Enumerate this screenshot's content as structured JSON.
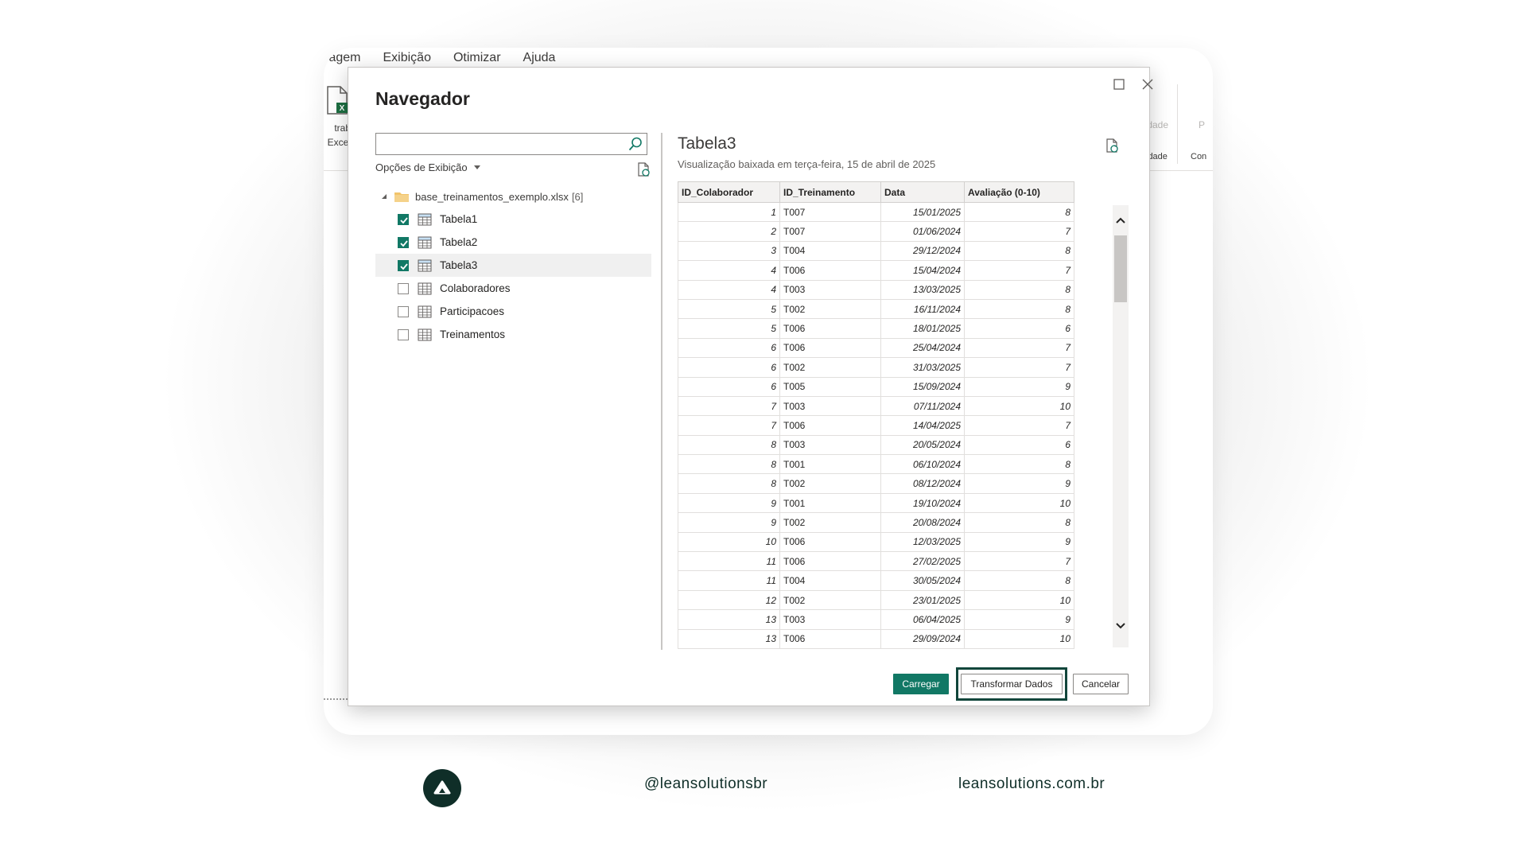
{
  "background_app": {
    "menu": [
      "elagem",
      "Exibição",
      "Otimizar",
      "Ajuda"
    ],
    "excel_label_line1": "trab",
    "excel_label_line2": "Excel",
    "ribbon_right_grey_1": "lidade",
    "ribbon_right_grey_2": "P",
    "ribbon_right_dark_1": "idade",
    "ribbon_right_dark_2": "Con"
  },
  "dialog": {
    "title": "Navegador",
    "search": {
      "value": "",
      "placeholder": ""
    },
    "display_options_label": "Opções de Exibição",
    "tree": {
      "root_label": "base_treinamentos_exemplo.xlsx",
      "root_count": "[6]",
      "items": [
        {
          "label": "Tabela1",
          "checked": true,
          "kind": "table"
        },
        {
          "label": "Tabela2",
          "checked": true,
          "kind": "table"
        },
        {
          "label": "Tabela3",
          "checked": true,
          "kind": "table",
          "selected": true
        },
        {
          "label": "Colaboradores",
          "checked": false,
          "kind": "sheet"
        },
        {
          "label": "Participacoes",
          "checked": false,
          "kind": "sheet"
        },
        {
          "label": "Treinamentos",
          "checked": false,
          "kind": "sheet"
        }
      ]
    },
    "preview": {
      "title": "Tabela3",
      "subtitle": "Visualização baixada em terça-feira, 15 de abril de 2025",
      "columns": [
        "ID_Colaborador",
        "ID_Treinamento",
        "Data",
        "Avaliação (0-10)"
      ],
      "rows": [
        [
          "1",
          "T007",
          "15/01/2025",
          "8"
        ],
        [
          "2",
          "T007",
          "01/06/2024",
          "7"
        ],
        [
          "3",
          "T004",
          "29/12/2024",
          "8"
        ],
        [
          "4",
          "T006",
          "15/04/2024",
          "7"
        ],
        [
          "4",
          "T003",
          "13/03/2025",
          "8"
        ],
        [
          "5",
          "T002",
          "16/11/2024",
          "8"
        ],
        [
          "5",
          "T006",
          "18/01/2025",
          "6"
        ],
        [
          "6",
          "T006",
          "25/04/2024",
          "7"
        ],
        [
          "6",
          "T002",
          "31/03/2025",
          "7"
        ],
        [
          "6",
          "T005",
          "15/09/2024",
          "9"
        ],
        [
          "7",
          "T003",
          "07/11/2024",
          "10"
        ],
        [
          "7",
          "T006",
          "14/04/2025",
          "7"
        ],
        [
          "8",
          "T003",
          "20/05/2024",
          "6"
        ],
        [
          "8",
          "T001",
          "06/10/2024",
          "8"
        ],
        [
          "8",
          "T002",
          "08/12/2024",
          "9"
        ],
        [
          "9",
          "T001",
          "19/10/2024",
          "10"
        ],
        [
          "9",
          "T002",
          "20/08/2024",
          "8"
        ],
        [
          "10",
          "T006",
          "12/03/2025",
          "9"
        ],
        [
          "11",
          "T006",
          "27/02/2025",
          "7"
        ],
        [
          "11",
          "T004",
          "30/05/2024",
          "8"
        ],
        [
          "12",
          "T002",
          "23/01/2025",
          "10"
        ],
        [
          "13",
          "T003",
          "06/04/2025",
          "9"
        ],
        [
          "13",
          "T006",
          "29/09/2024",
          "10"
        ]
      ]
    },
    "buttons": {
      "load": "Carregar",
      "transform": "Transformar Dados",
      "cancel": "Cancelar"
    },
    "icons": {
      "maximize": "maximize-icon",
      "close": "close-icon",
      "search": "search-icon",
      "refresh": "refresh-document-icon"
    }
  },
  "branding": {
    "handle": "@leansolutionsbr",
    "url": "leansolutions.com.br",
    "accent": "#117865",
    "dark": "#0f2e28"
  }
}
